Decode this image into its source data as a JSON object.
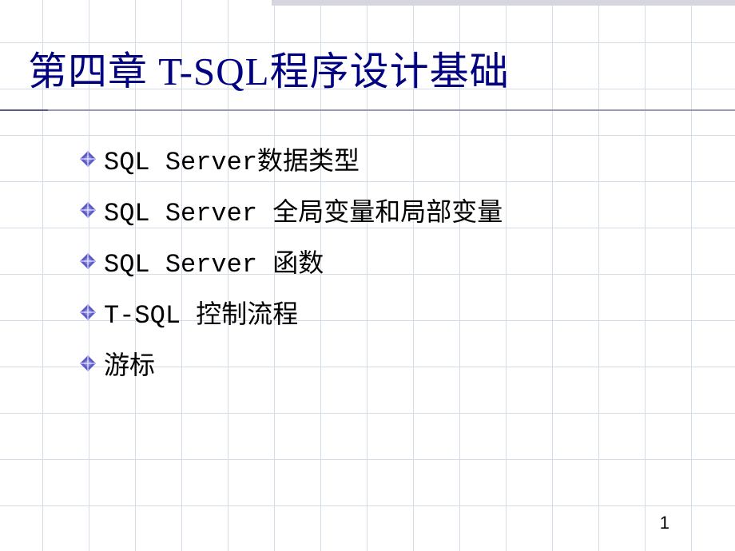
{
  "slide": {
    "title": "第四章 T-SQL程序设计基础",
    "bullets": [
      "SQL  Server数据类型",
      "SQL  Server 全局变量和局部变量",
      "SQL  Server 函数",
      "T-SQL 控制流程",
      "游标"
    ],
    "page_number": "1"
  }
}
